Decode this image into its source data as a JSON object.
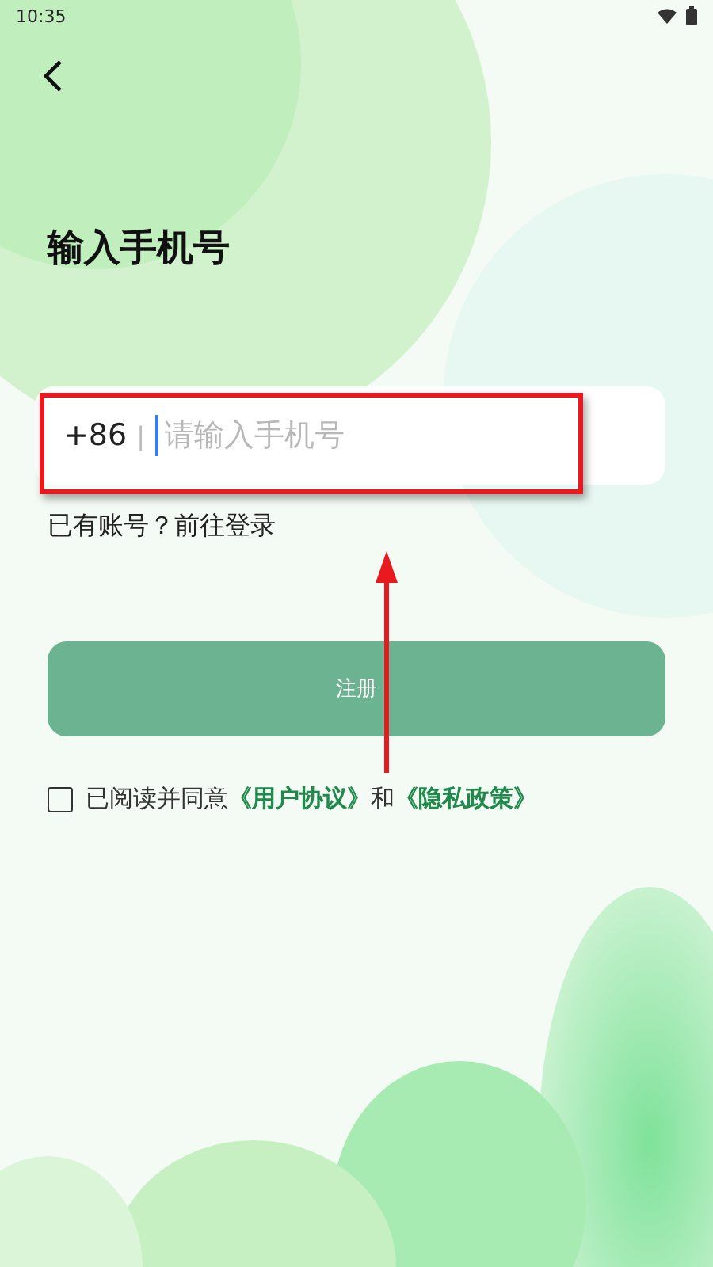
{
  "status_bar": {
    "time": "10:35"
  },
  "title": "输入手机号",
  "phone": {
    "country_code": "+86",
    "separator": "|",
    "placeholder": "请输入手机号",
    "focused": true
  },
  "login_link": "已有账号？前往登录",
  "register_button": {
    "label": "注册",
    "disabled": true
  },
  "agreement": {
    "checked": false,
    "prefix": "已阅读并同意",
    "terms_link": "《用户协议》",
    "conjunction": "和",
    "privacy_link": "《隐私政策》"
  },
  "annotation": {
    "kind": "highlight-arrow"
  }
}
